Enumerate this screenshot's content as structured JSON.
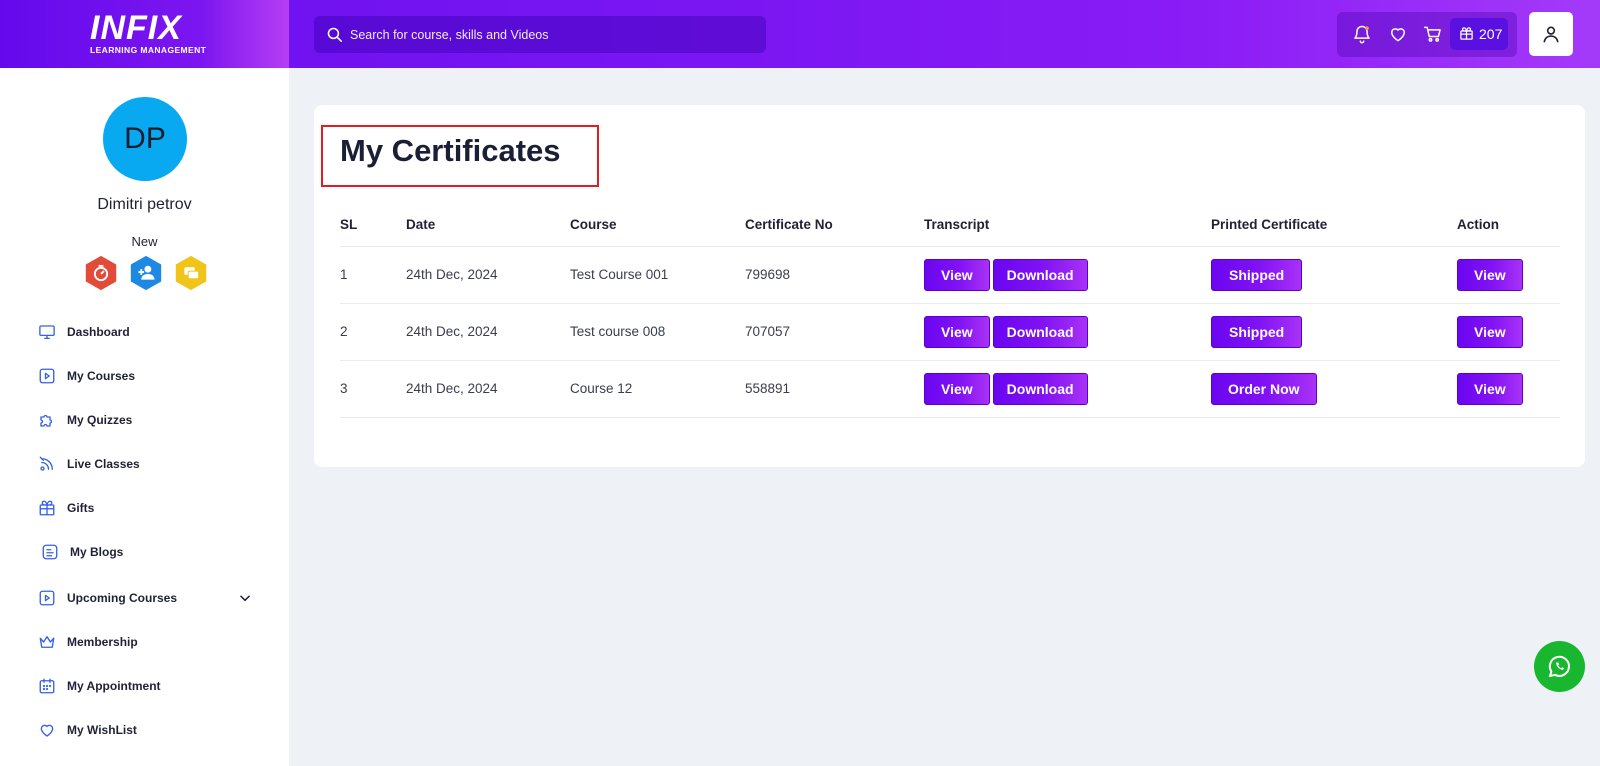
{
  "header": {
    "brand": "INFIX",
    "brand_tagline": "LEARNING MANAGEMENT",
    "search_placeholder": "Search for course, skills and Videos",
    "gift_points": "207",
    "icons": [
      "bell-icon",
      "heart-icon",
      "cart-icon",
      "gift-icon",
      "user-icon"
    ]
  },
  "sidebar": {
    "avatar_initials": "DP",
    "user_name": "Dimitri petrov",
    "user_level": "New",
    "badges": [
      {
        "name": "timer-badge",
        "color": "#e24a3a"
      },
      {
        "name": "add-user-badge",
        "color": "#1e88e5"
      },
      {
        "name": "chat-badge",
        "color": "#f0c419"
      }
    ],
    "items": [
      {
        "label": "Dashboard",
        "icon": "monitor-icon"
      },
      {
        "label": "My Courses",
        "icon": "play-square-icon"
      },
      {
        "label": "My Quizzes",
        "icon": "puzzle-icon"
      },
      {
        "label": "Live Classes",
        "icon": "satellite-icon"
      },
      {
        "label": "Gifts",
        "icon": "gift-icon"
      },
      {
        "label": "My Blogs",
        "icon": "blog-icon"
      },
      {
        "label": "Upcoming Courses",
        "icon": "play-square-icon",
        "has_submenu": true
      },
      {
        "label": "Membership",
        "icon": "crown-icon"
      },
      {
        "label": "My Appointment",
        "icon": "calendar-icon"
      },
      {
        "label": "My WishList",
        "icon": "heart-icon"
      }
    ]
  },
  "main": {
    "title": "My Certificates",
    "columns": [
      "SL",
      "Date",
      "Course",
      "Certificate No",
      "Transcript",
      "Printed Certificate",
      "Action"
    ],
    "rows": [
      {
        "sl": "1",
        "date": "24th Dec, 2024",
        "course": "Test Course 001",
        "cert_no": "799698",
        "transcript_view": "View",
        "transcript_download": "Download",
        "printed": "Shipped",
        "action": "View"
      },
      {
        "sl": "2",
        "date": "24th Dec, 2024",
        "course": "Test course 008",
        "cert_no": "707057",
        "transcript_view": "View",
        "transcript_download": "Download",
        "printed": "Shipped",
        "action": "View"
      },
      {
        "sl": "3",
        "date": "24th Dec, 2024",
        "course": "Course 12",
        "cert_no": "558891",
        "transcript_view": "View",
        "transcript_download": "Download",
        "printed": "Order Now",
        "action": "View"
      }
    ]
  },
  "colors": {
    "brand_purple": "#7a16f2",
    "accent_gradient_end": "#a932f6",
    "avatar_blue": "#09a9f2",
    "highlight_red": "#e31b23",
    "whatsapp_green": "#19b72f"
  }
}
